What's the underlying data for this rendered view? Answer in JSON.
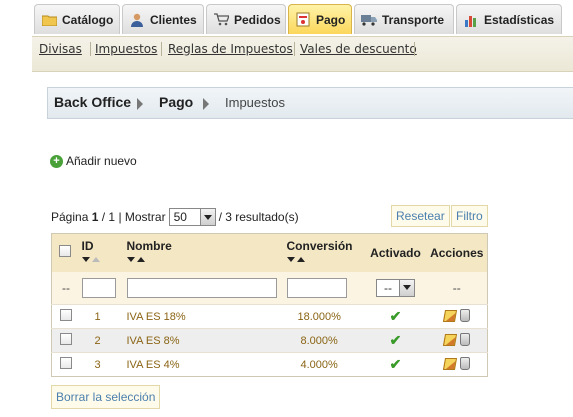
{
  "tabs": [
    {
      "label": "Catálogo",
      "icon": "folder-icon"
    },
    {
      "label": "Clientes",
      "icon": "user-icon"
    },
    {
      "label": "Pedidos",
      "icon": "cart-icon"
    },
    {
      "label": "Pago",
      "icon": "payment-icon",
      "active": true
    },
    {
      "label": "Transporte",
      "icon": "truck-icon"
    },
    {
      "label": "Estadísticas",
      "icon": "chart-icon"
    }
  ],
  "submenu": [
    "Divisas",
    "Impuestos",
    "Reglas de Impuestos",
    "Vales de descuento"
  ],
  "breadcrumb": {
    "root": "Back Office",
    "section": "Pago",
    "current": "Impuestos"
  },
  "add_new": "Añadir nuevo",
  "pager": {
    "page_label": "Página",
    "page": "1",
    "total_pages": "/ 1",
    "show_label": "| Mostrar",
    "per_page": "50",
    "results": "/ 3 resultado(s)"
  },
  "buttons": {
    "reset": "Resetear",
    "filter": "Filtro",
    "clear_selection": "Borrar la selección"
  },
  "table": {
    "headers": {
      "id": "ID",
      "name": "Nombre",
      "conversion": "Conversión",
      "active": "Activado",
      "actions": "Acciones"
    },
    "filters": {
      "checkbox_placeholder": "--",
      "active_select": "--",
      "actions_placeholder": "--"
    },
    "rows": [
      {
        "id": "1",
        "name": "IVA ES 18%",
        "conversion": "18.000%"
      },
      {
        "id": "2",
        "name": "IVA ES 8%",
        "conversion": "8.000%"
      },
      {
        "id": "3",
        "name": "IVA ES 4%",
        "conversion": "4.000%"
      }
    ]
  },
  "colors": {
    "accent_link": "#4a7fae",
    "active_tab": "#fbd75b",
    "row_text": "#8a6414",
    "check": "#3a9a2a"
  }
}
